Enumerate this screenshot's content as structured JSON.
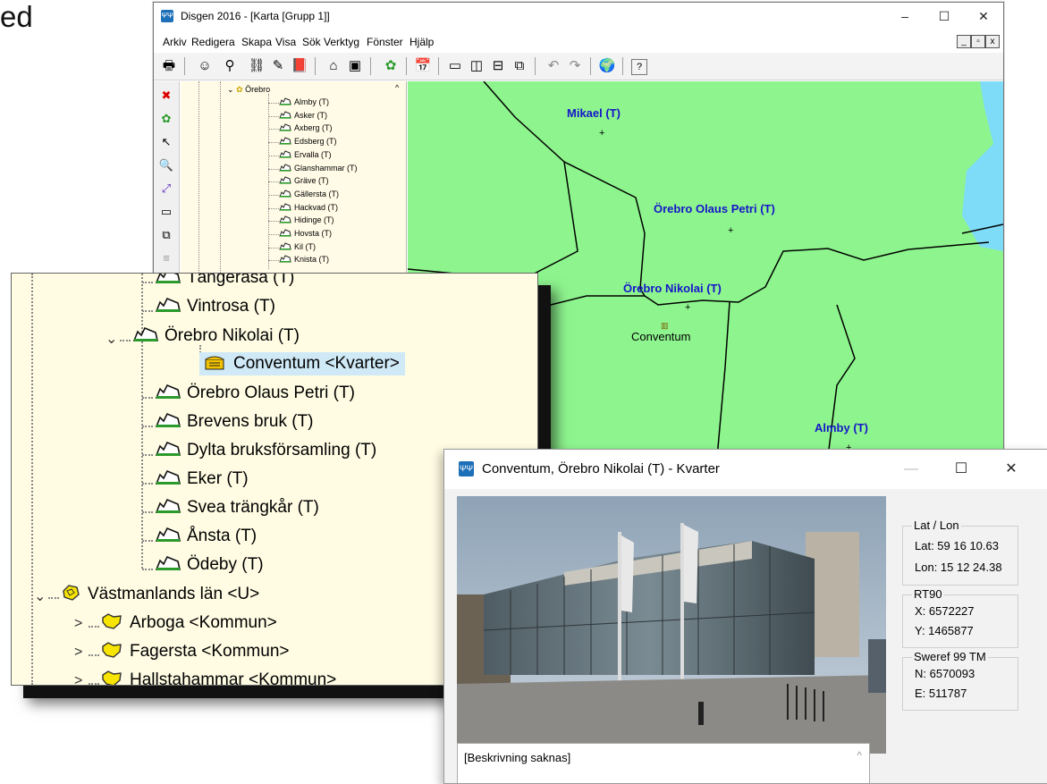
{
  "edge_text": "ed",
  "main_window": {
    "title": "Disgen 2016 - [Karta [Grupp 1]]",
    "app_icon": "ΨΨ",
    "controls": {
      "minimize": "–",
      "maximize": "☐",
      "close": "✕"
    },
    "menu": [
      "Arkiv",
      "Redigera",
      "Skapa",
      "Visa",
      "Sök",
      "Verktyg",
      "Fönster",
      "Hjälp"
    ],
    "mdi_controls": [
      "_",
      "▫",
      "x"
    ],
    "toolbar_icons": [
      "printer-icon",
      "person-icon",
      "search-person-icon",
      "binoculars-icon",
      "notes-icon",
      "book-icon",
      "home-icon",
      "archive-icon",
      "map-icon",
      "calendar-icon",
      "layout-1-icon",
      "layout-2-icon",
      "layout-3-icon",
      "layout-4-icon",
      "undo-icon",
      "redo-icon",
      "globe-icon",
      "help-icon"
    ],
    "toolbar_glyphs": [
      "🖶",
      "☺",
      "⚲",
      "⛓",
      "✎",
      "📕",
      "⌂",
      "▣",
      "✿",
      "📅",
      "▭",
      "◫",
      "⊟",
      "⧉",
      "↶",
      "↷",
      "🌍",
      "?"
    ],
    "left_tools": [
      {
        "name": "close-red-icon",
        "glyph": "✖"
      },
      {
        "name": "map-green-icon",
        "glyph": "✿"
      },
      {
        "name": "pointer-icon",
        "glyph": "↖"
      },
      {
        "name": "zoom-icon",
        "glyph": "🔍"
      },
      {
        "name": "xy-icon",
        "glyph": "⤢"
      },
      {
        "name": "ruler-icon",
        "glyph": "▭"
      },
      {
        "name": "copy-icon",
        "glyph": "⧉"
      },
      {
        "name": "list-icon",
        "glyph": "≡"
      }
    ],
    "tree": {
      "parent": "Örebro",
      "items": [
        "Almby (T)",
        "Asker (T)",
        "Axberg (T)",
        "Edsberg (T)",
        "Ervalla (T)",
        "Glanshammar (T)",
        "Gräve (T)",
        "Gällersta (T)",
        "Hackvad (T)",
        "Hidinge (T)",
        "Hovsta (T)",
        "Kil (T)",
        "Knista (T)"
      ]
    },
    "map": {
      "labels": [
        "Mikael (T)",
        "Örebro Olaus Petri (T)",
        "Örebro Nikolai (T)",
        "Almby (T)"
      ],
      "poi": "Conventum",
      "colors": {
        "land": "#8ef58e",
        "water": "#7fdcf8",
        "label": "#1515c8"
      }
    }
  },
  "zoom_tree": {
    "items": [
      "Tängerasa (T)",
      "Vintrosa (T)",
      "Örebro Nikolai (T)",
      "Conventum <Kvarter>",
      "Örebro Olaus Petri (T)",
      "Brevens bruk (T)",
      "Dylta bruksförsamling (T)",
      "Eker (T)",
      "Svea trängkår (T)",
      "Ånsta (T)",
      "Ödeby (T)",
      "Västmanlands län <U>",
      "Arboga <Kommun>",
      "Fagersta <Kommun>",
      "Hallstahammar <Kommun>"
    ]
  },
  "detail_window": {
    "title": "Conventum, Örebro Nikolai (T) - Kvarter",
    "controls": {
      "minimize": "—",
      "maximize": "☐",
      "close": "✕"
    },
    "latlon": {
      "legend": "Lat / Lon",
      "lat": "Lat: 59 16 10.63",
      "lon": "Lon: 15 12 24.38"
    },
    "rt90": {
      "legend": "RT90",
      "x": "X: 6572227",
      "y": "Y: 1465877"
    },
    "sweref": {
      "legend": "Sweref 99 TM",
      "n": "N: 6570093",
      "e": "E: 511787"
    },
    "description": "[Beskrivning saknas]"
  }
}
